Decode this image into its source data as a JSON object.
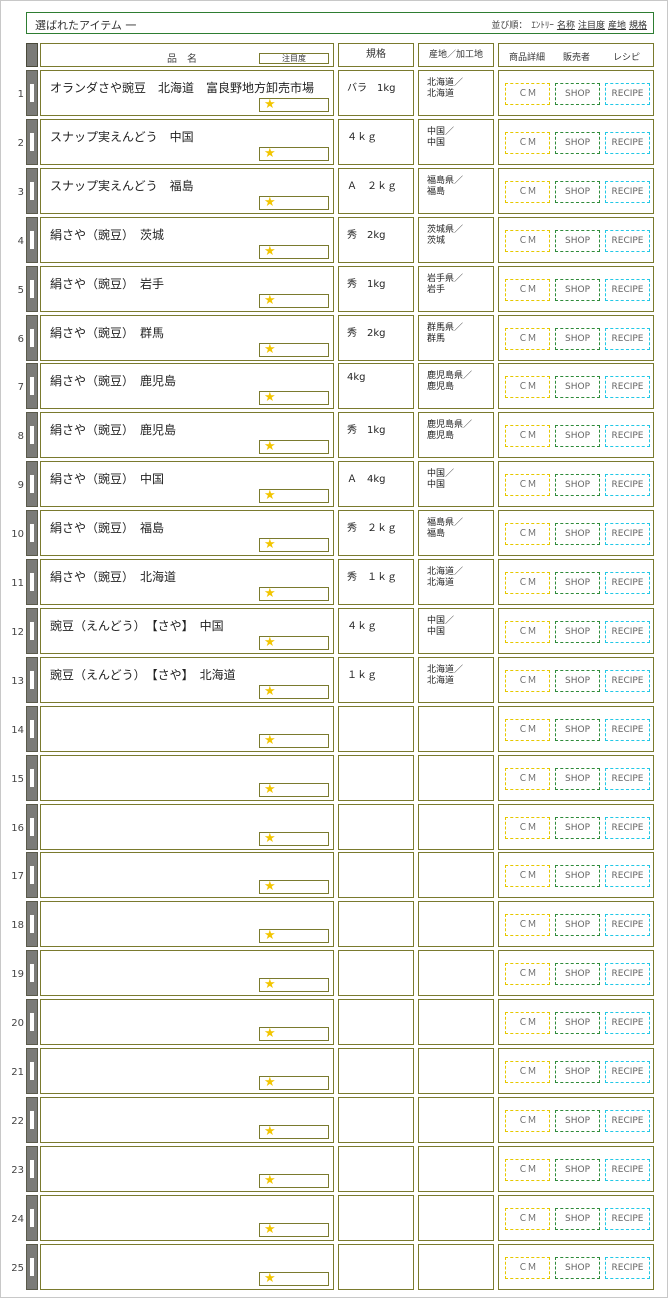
{
  "header": {
    "title": "選ばれたアイテム 一",
    "sort_label": "並び順：",
    "sort_options": [
      "ｴﾝﾄﾘｰ",
      "名称",
      "注目度",
      "産地",
      "規格"
    ]
  },
  "columns": {
    "name": "品名",
    "notice": "注目度",
    "spec": "規格",
    "origin": "産地／加工地",
    "detail": "商品詳細",
    "seller": "販売者",
    "recipe": "レシピ"
  },
  "buttons": {
    "cm": "ＣＭ",
    "shop": "SHOP",
    "recipe": "RECIPE"
  },
  "star": "★",
  "rows": [
    {
      "no": "1",
      "name": "オランダさや豌豆　北海道　富良野地方卸売市場",
      "spec": "バラ　1kg",
      "origin": "北海道／\n北海道"
    },
    {
      "no": "2",
      "name": "スナップ実えんどう　中国",
      "spec": "４ｋｇ",
      "origin": "中国／\n中国"
    },
    {
      "no": "3",
      "name": "スナップ実えんどう　福島",
      "spec": "Ａ　２ｋｇ",
      "origin": "福島県／\n福島"
    },
    {
      "no": "4",
      "name": "絹さや（豌豆）　茨城",
      "spec": "秀　2kg",
      "origin": "茨城県／\n茨城"
    },
    {
      "no": "5",
      "name": "絹さや（豌豆）　岩手",
      "spec": "秀　1kg",
      "origin": "岩手県／\n岩手"
    },
    {
      "no": "6",
      "name": "絹さや（豌豆）　群馬",
      "spec": "秀　2kg",
      "origin": "群馬県／\n群馬"
    },
    {
      "no": "7",
      "name": "絹さや（豌豆）　鹿児島",
      "spec": "4kg",
      "origin": "鹿児島県／\n鹿児島"
    },
    {
      "no": "8",
      "name": "絹さや（豌豆）　鹿児島",
      "spec": "秀　1kg",
      "origin": "鹿児島県／\n鹿児島"
    },
    {
      "no": "9",
      "name": "絹さや（豌豆）　中国",
      "spec": "Ａ　4kg",
      "origin": "中国／\n中国"
    },
    {
      "no": "10",
      "name": "絹さや（豌豆）　福島",
      "spec": "秀　２ｋｇ",
      "origin": "福島県／\n福島"
    },
    {
      "no": "11",
      "name": "絹さや（豌豆）　北海道",
      "spec": "秀　１ｋｇ",
      "origin": "北海道／\n北海道"
    },
    {
      "no": "12",
      "name": "豌豆（えんどう）　【さや】　中国",
      "spec": "４ｋｇ",
      "origin": "中国／\n中国"
    },
    {
      "no": "13",
      "name": "豌豆（えんどう）　【さや】　北海道",
      "spec": "１ｋｇ",
      "origin": "北海道／\n北海道"
    },
    {
      "no": "14",
      "name": "",
      "spec": "",
      "origin": ""
    },
    {
      "no": "15",
      "name": "",
      "spec": "",
      "origin": ""
    },
    {
      "no": "16",
      "name": "",
      "spec": "",
      "origin": ""
    },
    {
      "no": "17",
      "name": "",
      "spec": "",
      "origin": ""
    },
    {
      "no": "18",
      "name": "",
      "spec": "",
      "origin": ""
    },
    {
      "no": "19",
      "name": "",
      "spec": "",
      "origin": ""
    },
    {
      "no": "20",
      "name": "",
      "spec": "",
      "origin": ""
    },
    {
      "no": "21",
      "name": "",
      "spec": "",
      "origin": ""
    },
    {
      "no": "22",
      "name": "",
      "spec": "",
      "origin": ""
    },
    {
      "no": "23",
      "name": "",
      "spec": "",
      "origin": ""
    },
    {
      "no": "24",
      "name": "",
      "spec": "",
      "origin": ""
    },
    {
      "no": "25",
      "name": "",
      "spec": "",
      "origin": ""
    }
  ],
  "colors": {
    "border": "#7a7a2e",
    "topbar": "#2e7d32",
    "cm": "#e6c800",
    "shop": "#2e8b3a",
    "recipe": "#22c8e6",
    "star": "#f2c500"
  }
}
